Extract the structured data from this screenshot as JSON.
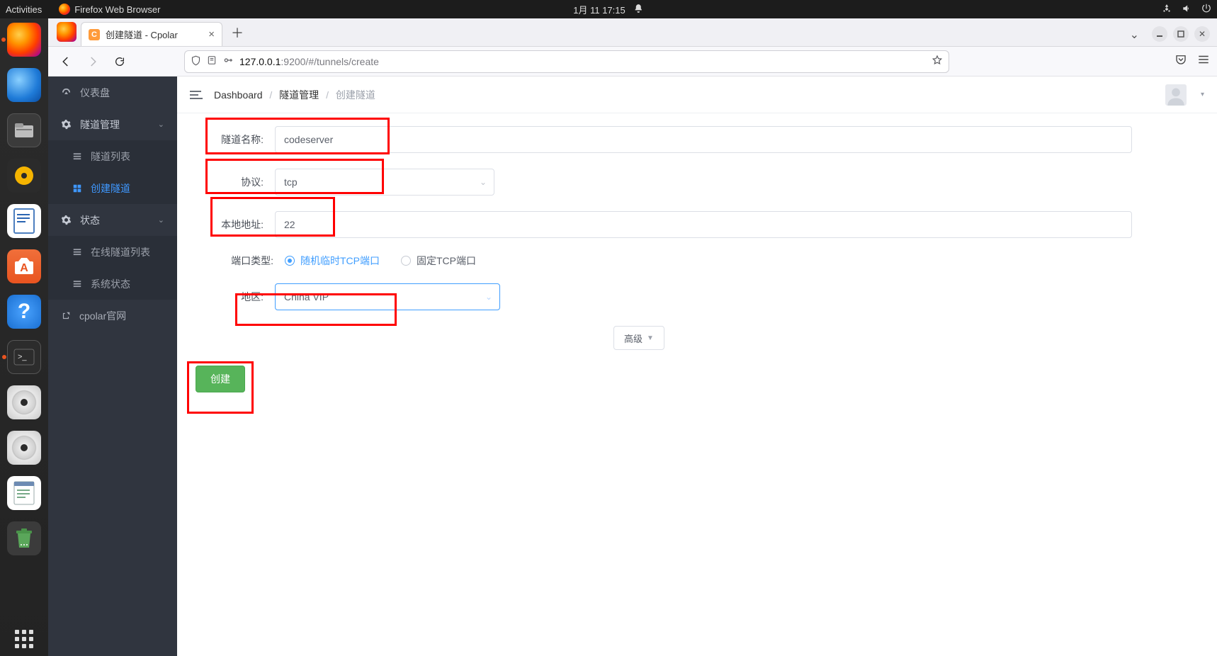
{
  "topbar": {
    "activities": "Activities",
    "app": "Firefox Web Browser",
    "datetime": "1月 11  17:15"
  },
  "browser": {
    "tab_title": "创建隧道 - Cpolar",
    "favicon_letter": "C",
    "url_host": "127.0.0.1",
    "url_rest": ":9200/#/tunnels/create"
  },
  "sidenav": {
    "dashboard": "仪表盘",
    "tunnel_mgmt": "隧道管理",
    "tunnel_list": "隧道列表",
    "tunnel_create": "创建隧道",
    "status": "状态",
    "online_list": "在线隧道列表",
    "sys_status": "系统状态",
    "official": "cpolar官网"
  },
  "crumbs": {
    "dashboard": "Dashboard",
    "tunnel_mgmt": "隧道管理",
    "create": "创建隧道"
  },
  "form": {
    "name_label": "隧道名称:",
    "name_value": "codeserver",
    "proto_label": "协议:",
    "proto_value": "tcp",
    "local_label": "本地地址:",
    "local_value": "22",
    "porttype_label": "端口类型:",
    "porttype_random": "随机临时TCP端口",
    "porttype_fixed": "固定TCP端口",
    "region_label": "地区:",
    "region_value": "China VIP",
    "advanced": "高级",
    "create": "创建"
  }
}
